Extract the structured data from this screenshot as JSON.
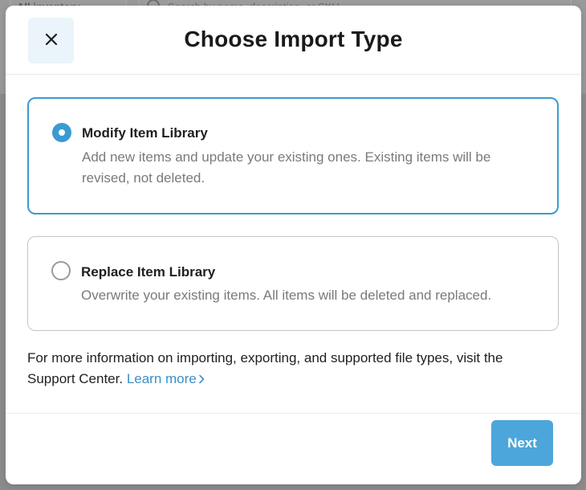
{
  "background": {
    "filter_label": "All inventory",
    "search_placeholder": "Search by name, description, or SKU"
  },
  "modal": {
    "title": "Choose Import Type",
    "close_icon": "close-icon",
    "options": [
      {
        "title": "Modify Item Library",
        "description": "Add new items and update your existing ones. Existing items will be revised, not deleted.",
        "selected": true
      },
      {
        "title": "Replace Item Library",
        "description": "Overwrite your existing items. All items will be deleted and replaced.",
        "selected": false
      }
    ],
    "info_text": "For more information on importing, exporting, and supported file types, visit the Support Center.",
    "learn_more": "Learn more",
    "learn_more_icon": "chevron-right-icon",
    "next_label": "Next"
  },
  "colors": {
    "accent": "#3a9bd1",
    "next_button": "#4da6db",
    "close_button_bg": "#eaf4fa",
    "link": "#3a8fc8"
  }
}
